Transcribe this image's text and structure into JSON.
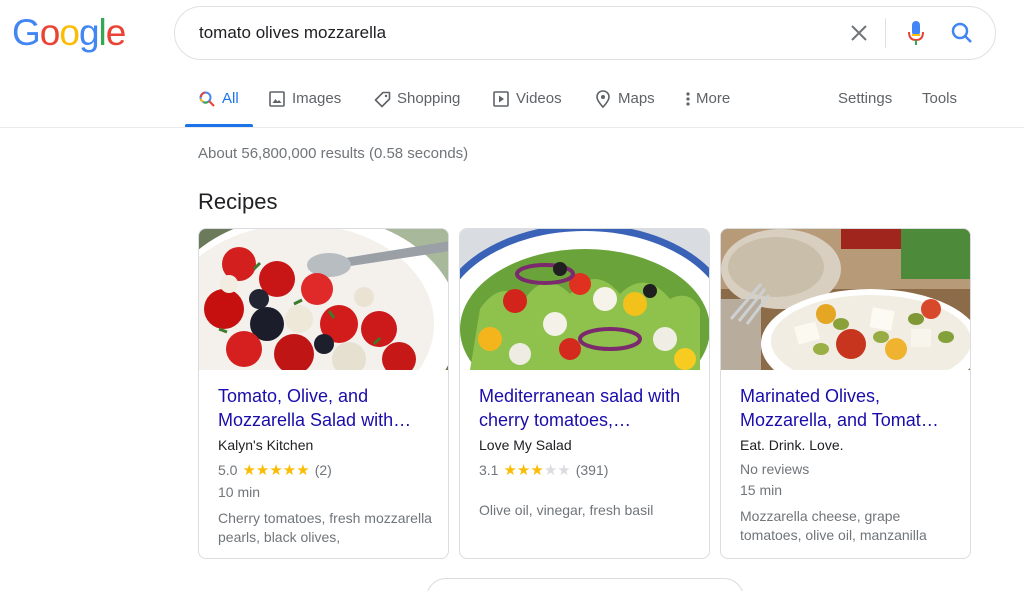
{
  "logo": {
    "letters": [
      "G",
      "o",
      "o",
      "g",
      "l",
      "e"
    ],
    "colors": [
      "#4285f4",
      "#ea4335",
      "#fbbc05",
      "#4285f4",
      "#34a853",
      "#ea4335"
    ]
  },
  "search": {
    "query": "tomato olives mozzarella"
  },
  "icons": {
    "clear": "close-icon",
    "mic": "mic-icon",
    "search": "search-icon"
  },
  "tabs": {
    "all": "All",
    "images": "Images",
    "shopping": "Shopping",
    "videos": "Videos",
    "maps": "Maps",
    "more": "More",
    "settings": "Settings",
    "tools": "Tools"
  },
  "stats": "About 56,800,000 results (0.58 seconds)",
  "section_title": "Recipes",
  "recipes": [
    {
      "title": "Tomato, Olive, and Mozzarella Salad with…",
      "source": "Kalyn's Kitchen",
      "rating": "5.0",
      "stars": 5,
      "reviews": "(2)",
      "time": "10 min",
      "ingredients": "Cherry tomatoes, fresh mozzarella pearls, black olives,"
    },
    {
      "title": "Mediterranean salad with cherry tomatoes,…",
      "source": "Love My Salad",
      "rating": "3.1",
      "stars": 3,
      "reviews": "(391)",
      "ingredients": "Olive oil, vinegar, fresh basil"
    },
    {
      "title": "Marinated Olives, Mozzarella, and Tomat…",
      "source": "Eat. Drink. Love.",
      "no_reviews": "No reviews",
      "time": "15 min",
      "ingredients": "Mozzarella cheese, grape tomatoes, olive oil, manzanilla"
    }
  ],
  "colors": {
    "link": "#1a0dab",
    "accent": "#1a73e8",
    "star": "#fbbc04"
  }
}
